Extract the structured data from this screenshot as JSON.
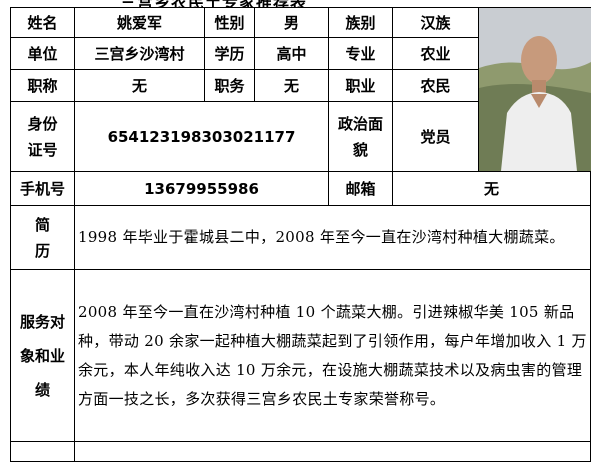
{
  "header_partial": "三宫乡农民土专家推荐表",
  "labels": {
    "name": "姓名",
    "gender": "性别",
    "ethnicity": "族别",
    "unit": "单位",
    "education": "学历",
    "major": "专业",
    "title": "职称",
    "position": "职务",
    "occupation": "职业",
    "id_line1": "身份",
    "id_line2": "证号",
    "politics_line1": "政治面",
    "politics_line2": "貌",
    "phone": "手机号",
    "email": "邮箱",
    "resume_line1": "简",
    "resume_line2": "历",
    "service_line1": "服务对",
    "service_line2": "象和业",
    "service_line3": "绩"
  },
  "values": {
    "name": "姚爱军",
    "gender": "男",
    "ethnicity": "汉族",
    "unit": "三宫乡沙湾村",
    "education": "高中",
    "major": "农业",
    "title": "无",
    "position": "无",
    "occupation": "农民",
    "id_number": "654123198303021177",
    "politics": "党员",
    "phone": "13679955986",
    "email": "无",
    "resume": "1998 年毕业于霍城县二中，2008 年至今一直在沙湾村种植大棚蔬菜。",
    "service": "2008 年至今一直在沙湾村种植 10 个蔬菜大棚。引进辣椒华美 105 新品种，带动 20 余家一起种植大棚蔬菜起到了引领作用，每户年增加收入 1 万余元，本人年纯收入达 10 万余元，在设施大棚蔬菜技术以及病虫害的管理方面一技之长，多次获得三宫乡农民土专家荣誉称号。"
  },
  "photo": {
    "icon": "portrait-photo",
    "colors": {
      "sky": "#c9cdd2",
      "hill": "#8f9a6e",
      "shirt": "#eeeeee",
      "skin": "#c79a7c"
    }
  }
}
